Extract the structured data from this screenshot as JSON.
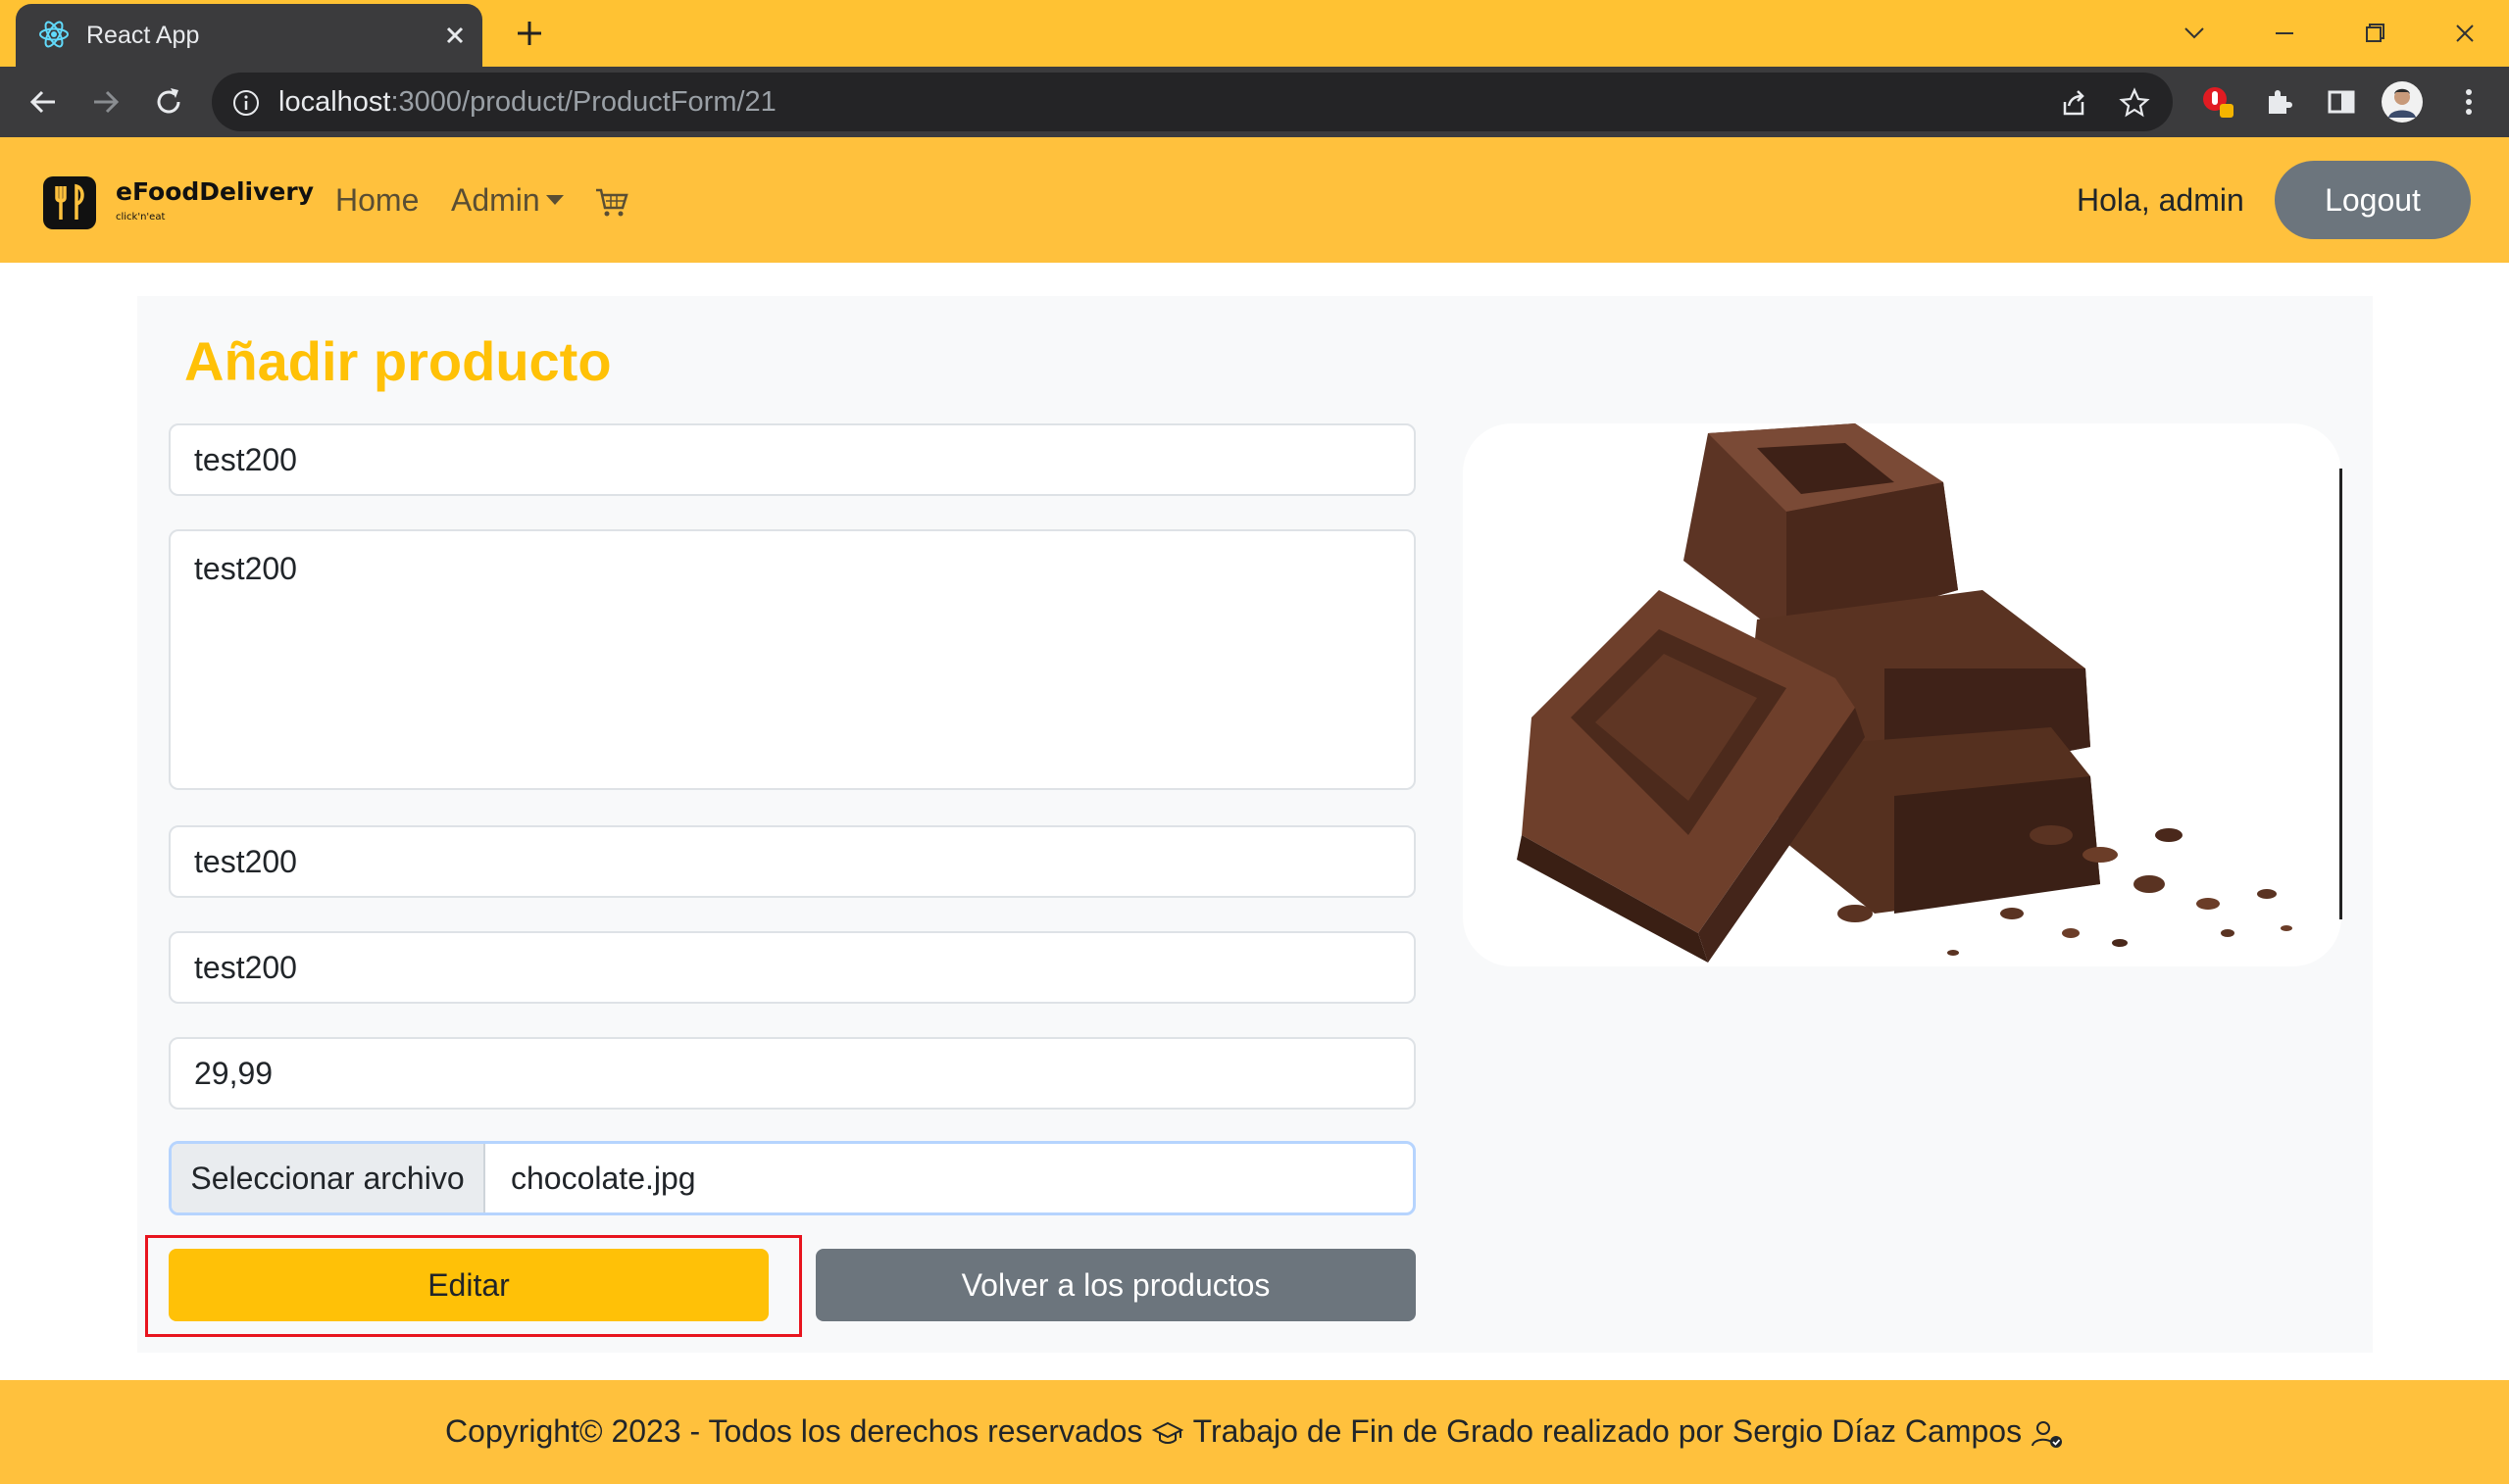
{
  "browser": {
    "tab_title": "React App",
    "url_host": "localhost",
    "url_path": ":3000/product/ProductForm/21"
  },
  "navbar": {
    "brand_name": "eFoodDelivery",
    "brand_tagline": "click'n'eat",
    "links": {
      "home": "Home",
      "admin": "Admin"
    },
    "greeting": "Hola, admin",
    "logout_label": "Logout"
  },
  "form": {
    "title": "Añadir producto",
    "name_value": "test200",
    "description_value": "test200",
    "field3_value": "test200",
    "field4_value": "test200",
    "price_value": "29,99",
    "file_button_label": "Seleccionar archivo",
    "file_name": "chocolate.jpg",
    "submit_label": "Editar",
    "back_label": "Volver a los productos"
  },
  "footer": {
    "text_part1": "Copyright© 2023 - Todos los derechos reservados",
    "text_part2": "Trabajo de Fin de Grado realizado por Sergio Díaz Campos"
  },
  "icons": [
    "react-favicon-icon",
    "close-icon",
    "plus-icon",
    "chevron-down-icon",
    "minimize-icon",
    "restore-icon",
    "window-close-icon",
    "back-arrow-icon",
    "forward-arrow-icon",
    "reload-icon",
    "info-icon",
    "share-icon",
    "star-icon",
    "extension-icon",
    "puzzle-icon",
    "sidebar-icon",
    "profile-avatar",
    "menu-dots-icon",
    "logo-icon",
    "cart-icon",
    "graduation-cap-icon",
    "user-check-icon"
  ],
  "colors": {
    "brand_yellow": "#ffc13d",
    "button_yellow": "#ffc107",
    "secondary_gray": "#6c757d",
    "highlight_red": "#e8141e"
  }
}
